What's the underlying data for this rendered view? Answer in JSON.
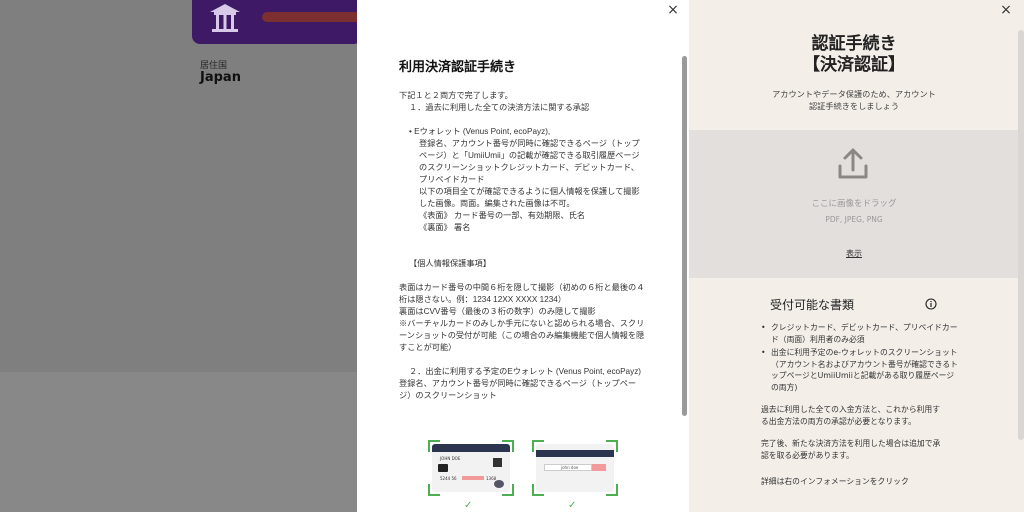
{
  "background": {
    "residence_label": "居住国",
    "residence_value": "Japan"
  },
  "modal": {
    "title": "利用決済認証手続き",
    "lines": [
      "下記１と２両方で完了します。",
      "１．過去に利用した全ての決済方法に関する承認"
    ],
    "ewallet": [
      "• Eウォレット (Venus Point, ecoPayz),",
      "登録名、アカウント番号が同時に確認できるページ（トップ",
      "ページ）と「UmiiUmii」の記載が確認できる取引履歴ページ",
      "のスクリーンショットクレジットカード、デビットカード、",
      "プリペイドカード",
      "以下の項目全てが確認できるように個人情報を保護して撮影",
      "した画像。両面。編集された画像は不可。",
      "《表面》 カード番号の一部、有効期限、氏名",
      "《裏面》 署名"
    ],
    "privacy_heading": "【個人情報保護事項】",
    "privacy": [
      "表面はカード番号の中間６桁を隠して撮影（初めの６桁と最後の４",
      "桁は隠さない。例：1234 12XX XXXX 1234）",
      "裏面はCVV番号（最後の３桁の数字）のみ隠して撮影",
      "※バーチャルカードのみしか手元にないと認められる場合、スクリ",
      "ーンショットの受付が可能（この場合のみ編集機能で個人情報を隠",
      "すことが可能）"
    ],
    "step2": [
      "２．出金に利用する予定のEウォレット (Venus Point, ecoPayz)",
      "登録名、アカウント番号が同時に確認できるページ（トップペー",
      "ジ）のスクリーンショット"
    ],
    "card_front_name": "JOHN DOE",
    "card_front_number": "5244 56",
    "card_front_tail": "1368",
    "card_back_sig": "john doe",
    "close_icon": "×"
  },
  "panel": {
    "title_line1": "認証手続き",
    "title_line2": "【決済認証】",
    "subtitle_line1": "アカウントやデータ保護のため、アカウント",
    "subtitle_line2": "認証手続きをしましょう",
    "dropzone_text": "ここに画像をドラッグ",
    "dropzone_formats": "PDF, JPEG, PNG",
    "example_link": "表示",
    "docs_title": "受付可能な書類",
    "docs": [
      "クレジットカード、デビットカード、プリペイドカード（両面）利用者のみ必須",
      "出金に利用予定のe-ウォレットのスクリーンショット（アカウント名およびアカウント番号が確認できるトップページとUmiiUmiiと記載がある取り履歴ページの両方)"
    ],
    "note1_line1": "過去に利用した全ての入金方法と、これから利用す",
    "note1_line2": "る出金方法の両方の承認が必要となります。",
    "note2_line1": "完了後、新たな決済方法を利用した場合は追加で承",
    "note2_line2": "認を取る必要があります。",
    "note3": "詳細は右のインフォメーションをクリック",
    "close_icon": "×"
  },
  "colors": {
    "brand_purple": "#3e1a66",
    "panel_bg": "#f3eee8",
    "accent_green": "#4caf50"
  }
}
